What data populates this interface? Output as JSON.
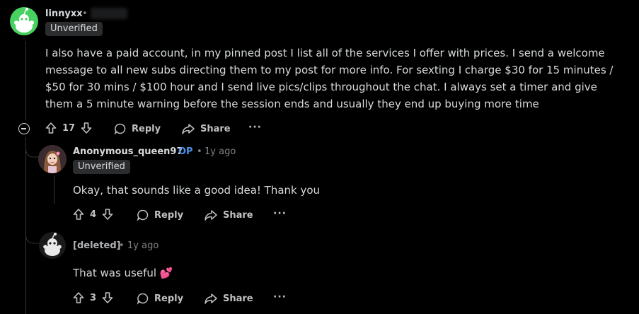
{
  "comments": [
    {
      "author": "linnyxx",
      "separator": "•",
      "flair": "Unverified",
      "avatar_color": "#46d160",
      "body": "I also have a paid account, in my pinned post I list all of the services I offer with prices. I send a welcome message to all new subs directing them to my post for more info. For sexting I charge $30 for 15 minutes / $50 for 30 mins / $100 hour and I send live pics/clips throughout the chat. I always set a timer and give them a 5 minute warning before the session ends and usually they end up buying more time",
      "votes": "17",
      "reply_label": "Reply",
      "share_label": "Share",
      "more_label": "···"
    },
    {
      "author": "Anonymous_queen97",
      "op_label": "OP",
      "separator": "•",
      "time": "1y ago",
      "flair": "Unverified",
      "body": "Okay, that sounds like a good idea! Thank you",
      "votes": "4",
      "reply_label": "Reply",
      "share_label": "Share",
      "more_label": "···"
    },
    {
      "author": "[deleted]",
      "separator": "•",
      "time": "1y ago",
      "body": "That was useful",
      "emoji": "💕",
      "votes": "3",
      "reply_label": "Reply",
      "share_label": "Share",
      "more_label": "···"
    }
  ],
  "colors": {
    "background": "#000000",
    "text": "#d7dadc",
    "muted": "#818384",
    "op_blue": "#4f8fe8",
    "badge_bg": "#2a2c2d",
    "thread_line": "#343536"
  }
}
